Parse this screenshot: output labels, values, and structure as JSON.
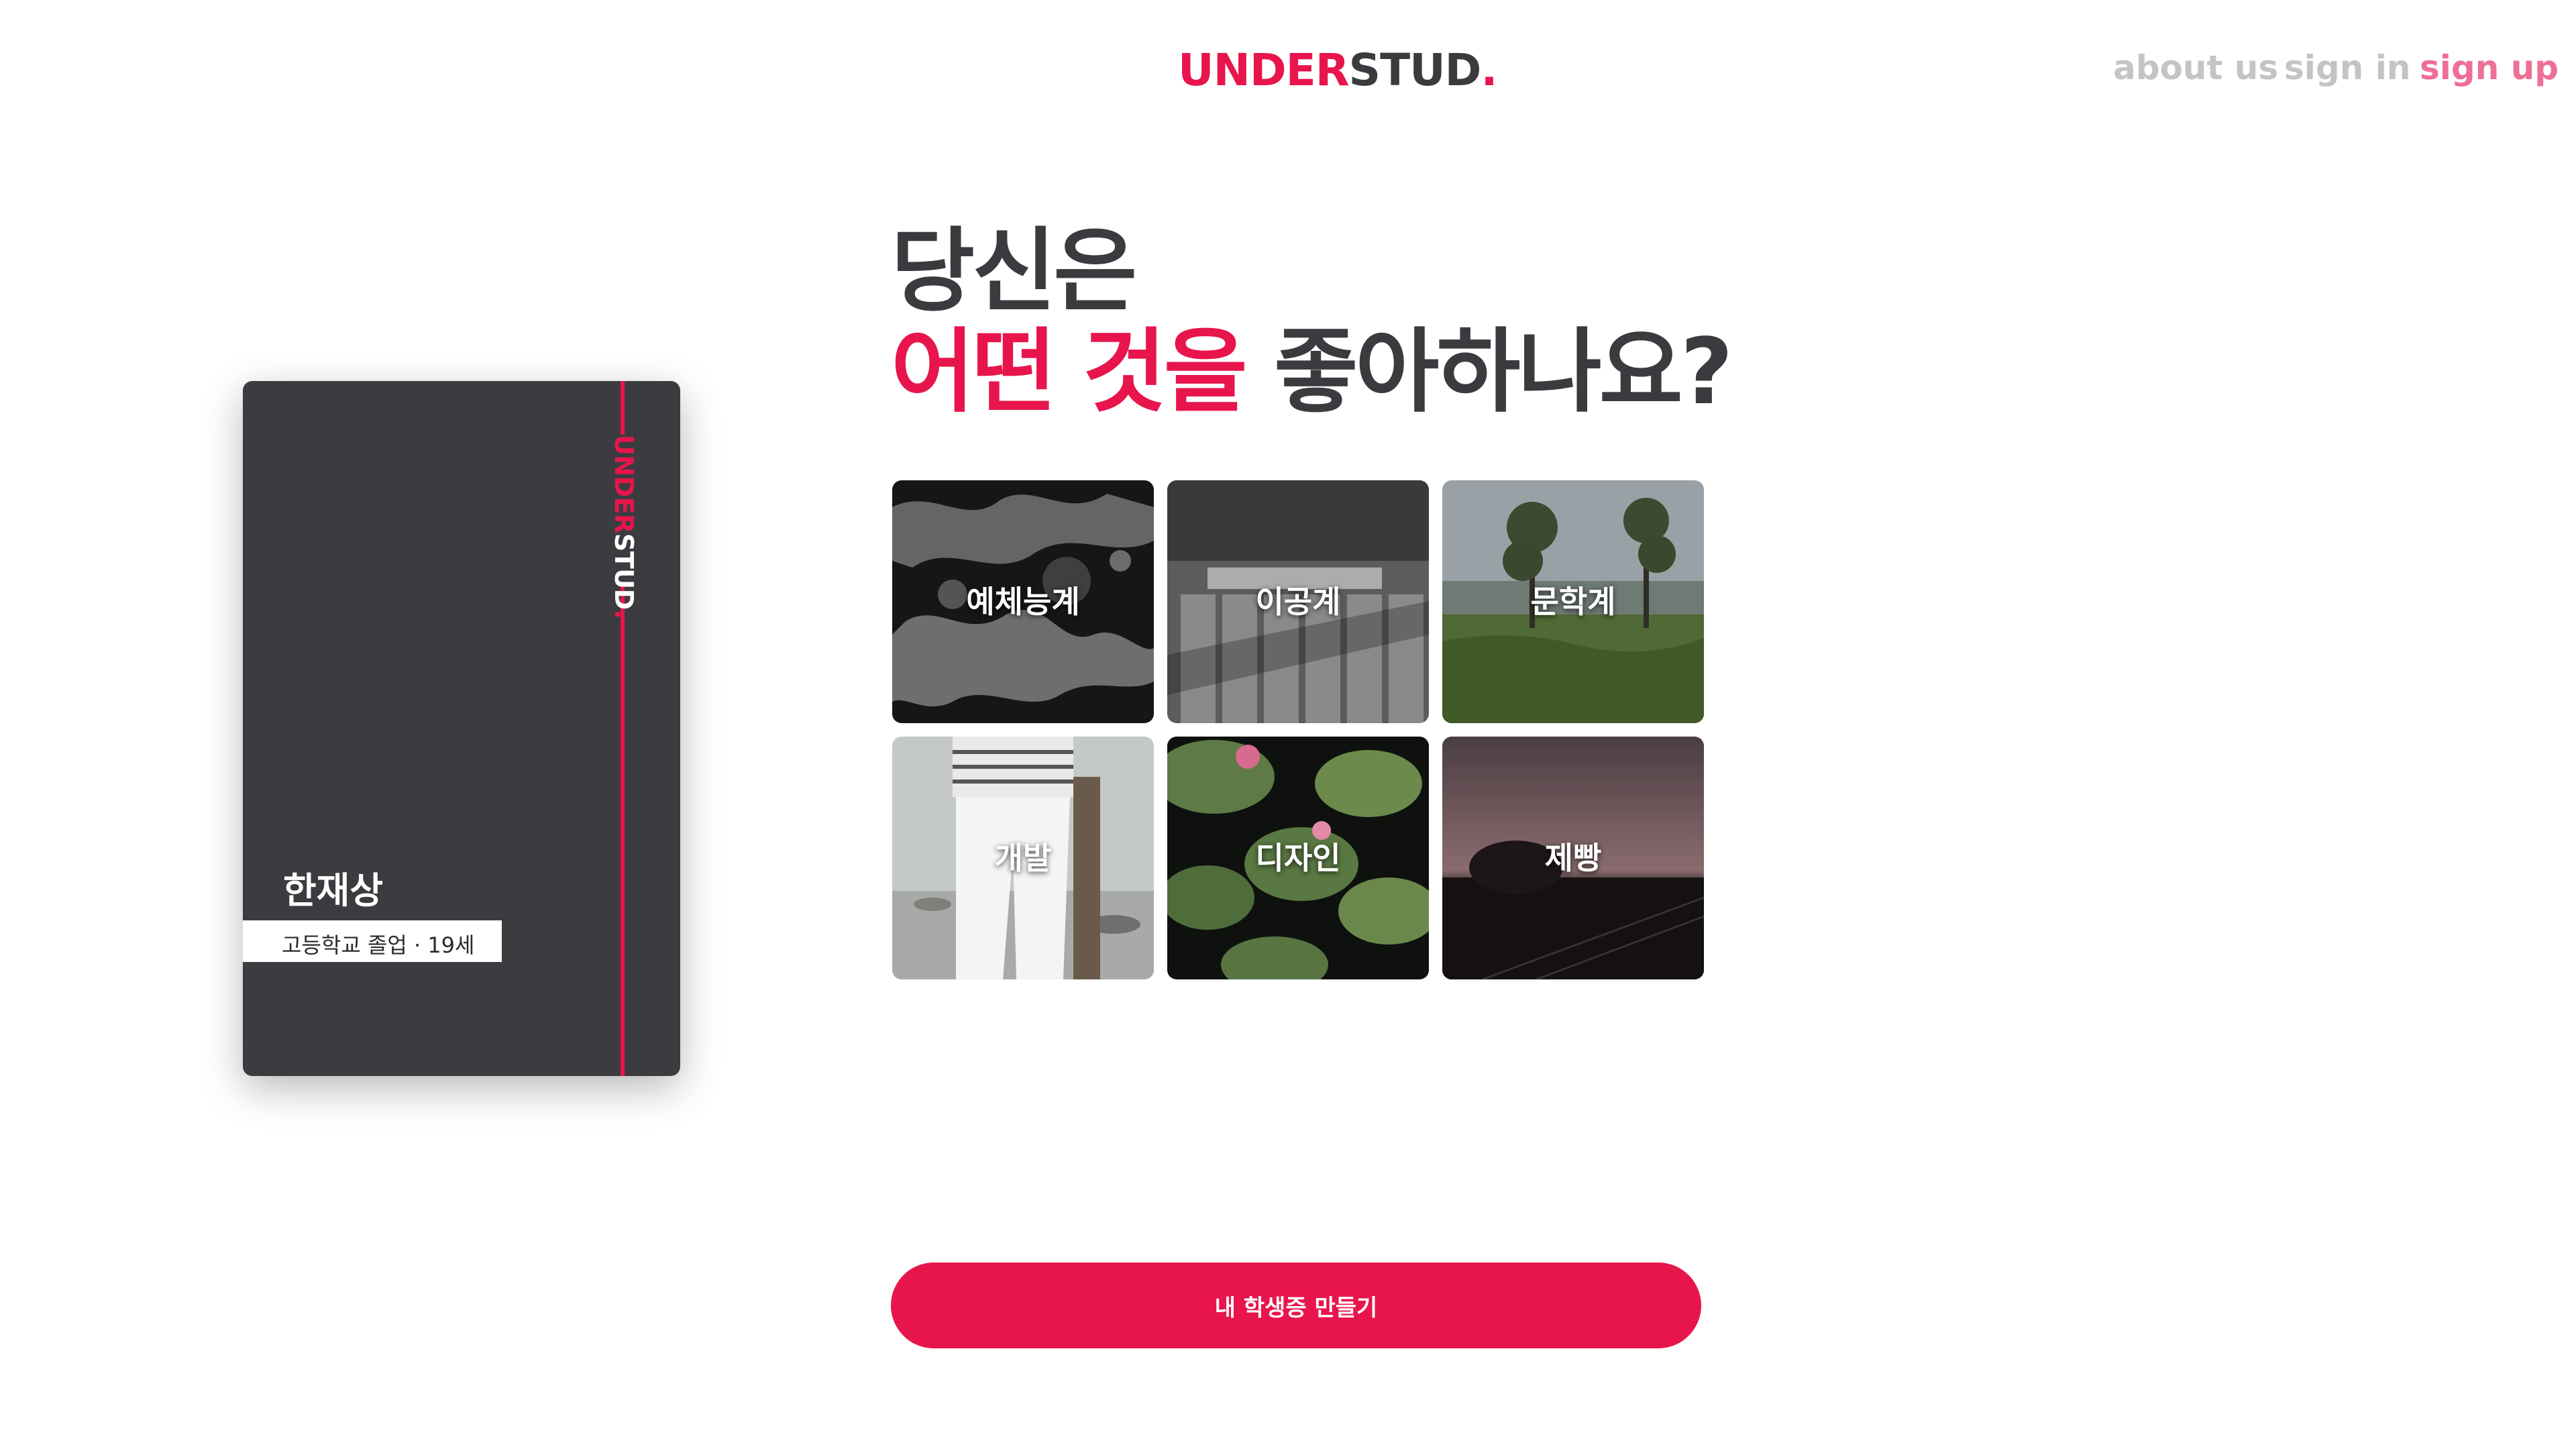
{
  "colors": {
    "accent": "#e8154c",
    "text_dark": "#3b3b3f",
    "nav_muted": "#c4c4c6",
    "nav_active": "#ee6f95",
    "card_bg": "#3c3c40"
  },
  "header": {
    "logo": {
      "part1": "UNDER",
      "part2": "STUD",
      "dot": "."
    },
    "nav": {
      "about": "about us",
      "sign_in": "sign in",
      "sign_up": "sign up"
    }
  },
  "card": {
    "logo": {
      "part1": "UNDER",
      "part2": "STUD",
      "dot": "."
    },
    "name": "한재상",
    "info": "고등학교 졸업 · 19세"
  },
  "heading": {
    "line1": "당신은",
    "accent": "어떤 것을",
    "rest": " 좋아하나요?"
  },
  "categories": [
    {
      "label": "예체능계"
    },
    {
      "label": "이공계"
    },
    {
      "label": "문학계"
    },
    {
      "label": "개발"
    },
    {
      "label": "디자인"
    },
    {
      "label": "제빵"
    }
  ],
  "cta": {
    "label": "내 학생증 만들기"
  }
}
